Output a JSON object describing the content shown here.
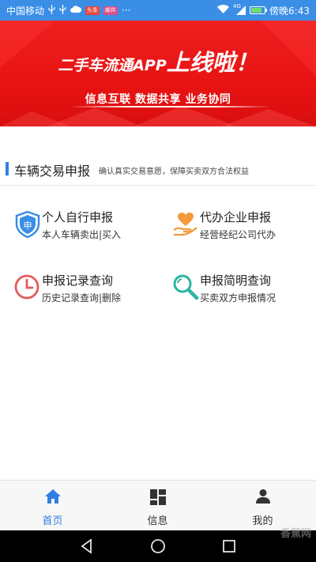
{
  "status_bar": {
    "carrier": "中国移动",
    "badge1": "头条",
    "badge2": "邮件",
    "more": "···",
    "network": "4G",
    "time": "傍晚6:43",
    "battery_level": 0.8
  },
  "banner": {
    "title_part1": "二手车流通APP",
    "title_part2": "上线啦！",
    "subtitle": "信息互联  数据共享  业务协同"
  },
  "section": {
    "title": "车辆交易申报",
    "subtitle": "确认真实交易意愿，保障买卖双方合法权益"
  },
  "items": [
    {
      "title": "个人自行申报",
      "desc": "本人车辆卖出|买入",
      "icon": "shield-shen-icon",
      "color": "#3a8ee6"
    },
    {
      "title": "代办企业申报",
      "desc": "经营经纪公司代办",
      "icon": "hand-heart-icon",
      "color": "#f39a3c"
    },
    {
      "title": "申报记录查询",
      "desc": "历史记录查询|删除",
      "icon": "clock-icon",
      "color": "#e85a5a"
    },
    {
      "title": "申报简明查询",
      "desc": "买卖双方申报情况",
      "icon": "magnifier-icon",
      "color": "#2bb5a0"
    }
  ],
  "bottom_nav": [
    {
      "label": "首页",
      "icon": "home-icon",
      "active": true
    },
    {
      "label": "信息",
      "icon": "dashboard-icon",
      "active": false
    },
    {
      "label": "我的",
      "icon": "person-icon",
      "active": false
    }
  ],
  "colors": {
    "accent": "#2f7fe0",
    "status_bar": "#3a8ee6",
    "banner": "#e81313",
    "nav_active": "#2f7fe0",
    "nav_inactive": "#333333"
  },
  "watermark": "香蕉网"
}
